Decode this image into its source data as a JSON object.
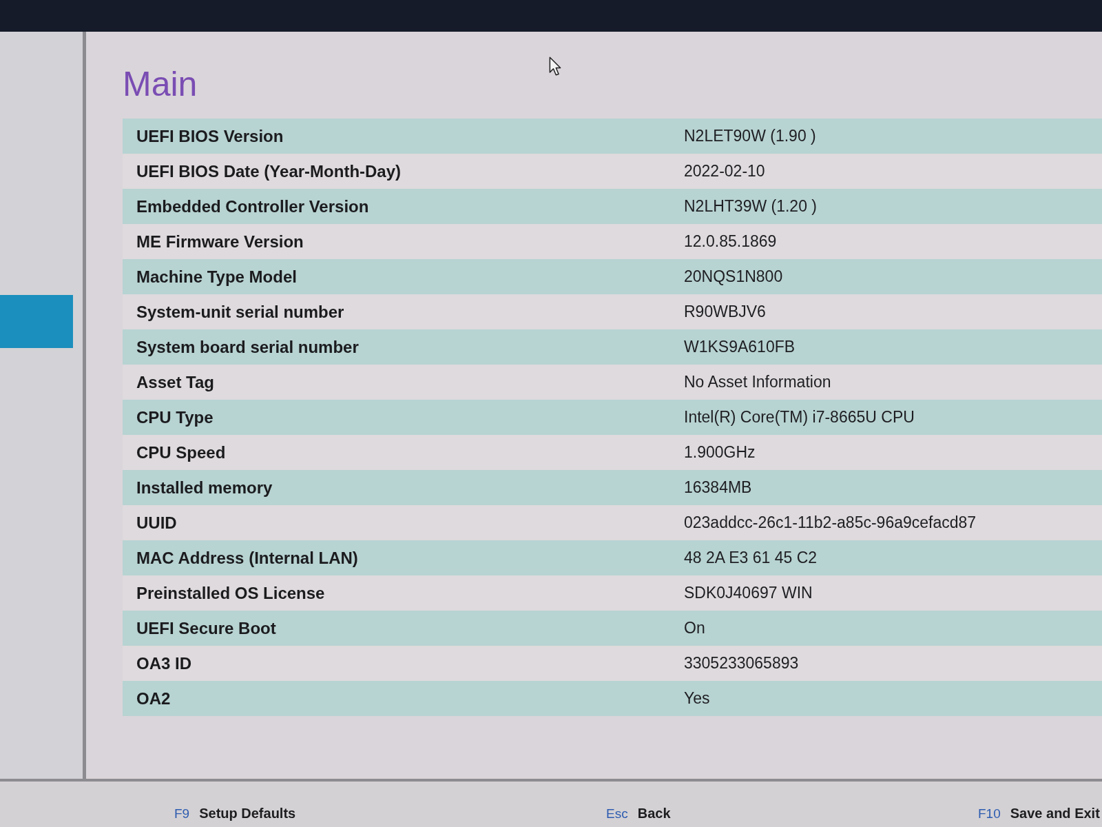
{
  "page": {
    "title": "Main"
  },
  "info": [
    {
      "label": "UEFI BIOS Version",
      "value": "N2LET90W (1.90 )"
    },
    {
      "label": "UEFI BIOS Date (Year-Month-Day)",
      "value": "2022-02-10"
    },
    {
      "label": "Embedded Controller Version",
      "value": "N2LHT39W (1.20 )"
    },
    {
      "label": "ME Firmware Version",
      "value": "12.0.85.1869"
    },
    {
      "label": "Machine Type Model",
      "value": "20NQS1N800"
    },
    {
      "label": "System-unit serial number",
      "value": "R90WBJV6"
    },
    {
      "label": "System board serial number",
      "value": "W1KS9A610FB"
    },
    {
      "label": "Asset Tag",
      "value": "No Asset Information"
    },
    {
      "label": "CPU Type",
      "value": "Intel(R) Core(TM) i7-8665U CPU"
    },
    {
      "label": "CPU Speed",
      "value": "1.900GHz"
    },
    {
      "label": "Installed memory",
      "value": "16384MB"
    },
    {
      "label": "UUID",
      "value": "023addcc-26c1-11b2-a85c-96a9cefacd87"
    },
    {
      "label": "MAC Address (Internal LAN)",
      "value": "48 2A E3 61 45 C2"
    },
    {
      "label": "Preinstalled OS License",
      "value": "SDK0J40697 WIN"
    },
    {
      "label": "UEFI Secure Boot",
      "value": "On"
    },
    {
      "label": "OA3 ID",
      "value": "3305233065893"
    },
    {
      "label": "OA2",
      "value": "Yes"
    }
  ],
  "footer": [
    {
      "key": "F9",
      "action": "Setup Defaults"
    },
    {
      "key": "Esc",
      "action": "Back"
    },
    {
      "key": "F10",
      "action": "Save and Exit"
    }
  ]
}
